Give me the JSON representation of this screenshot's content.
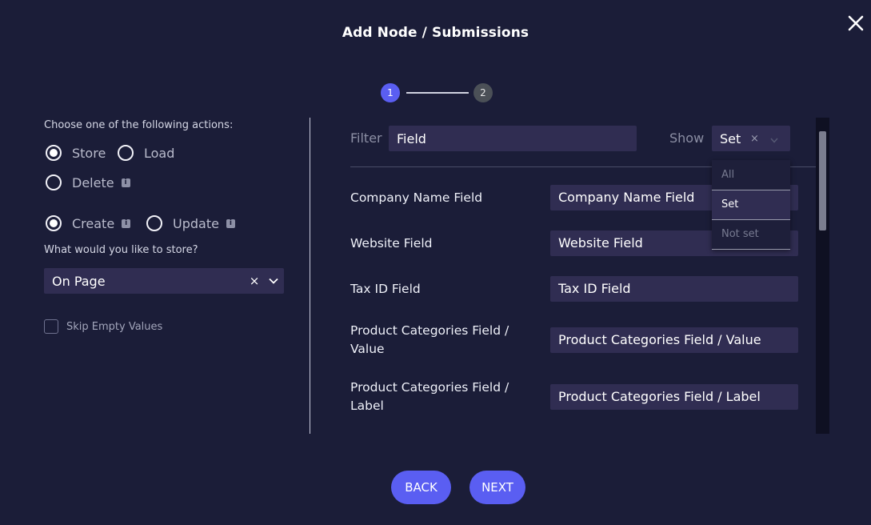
{
  "header": {
    "title": "Add Node / Submissions",
    "close_icon": "close-icon"
  },
  "stepper": {
    "steps": [
      "1",
      "2"
    ],
    "current_step": 1,
    "active_color": "#5a5ef2"
  },
  "left_panel": {
    "actions_label": "Choose one of the following actions:",
    "actions": [
      {
        "label": "Store",
        "checked": true
      },
      {
        "label": "Load",
        "checked": false
      },
      {
        "label": "Delete",
        "checked": false
      }
    ],
    "modes": [
      {
        "label": "Create",
        "checked": true
      },
      {
        "label": "Update",
        "checked": false
      }
    ],
    "info_glyph": "i",
    "store_question": "What would you like to store?",
    "store_select": {
      "value": "On Page",
      "clear_glyph": "×"
    },
    "skip_empty": {
      "label": "Skip Empty Values",
      "checked": false
    }
  },
  "right_panel": {
    "filter": {
      "label": "Filter",
      "value": "Field"
    },
    "show": {
      "label": "Show",
      "value": "Set",
      "clear_glyph": "×",
      "options": [
        {
          "label": "All",
          "selected": false
        },
        {
          "label": "Set",
          "selected": true
        },
        {
          "label": "Not set",
          "selected": false
        }
      ]
    },
    "fields": [
      {
        "label": "Company Name Field",
        "value": "Company Name Field"
      },
      {
        "label": "Website Field",
        "value": "Website Field"
      },
      {
        "label": "Tax ID Field",
        "value": "Tax ID Field"
      },
      {
        "label": "Product Categories Field / Value",
        "value": "Product Categories Field / Value"
      },
      {
        "label": "Product Categories Field / Label",
        "value": "Product Categories Field / Label"
      }
    ]
  },
  "footer": {
    "back_label": "BACK",
    "next_label": "NEXT"
  },
  "colors": {
    "background": "#1b1d38",
    "input_bg": "#302d52",
    "accent": "#5a5ef2"
  }
}
